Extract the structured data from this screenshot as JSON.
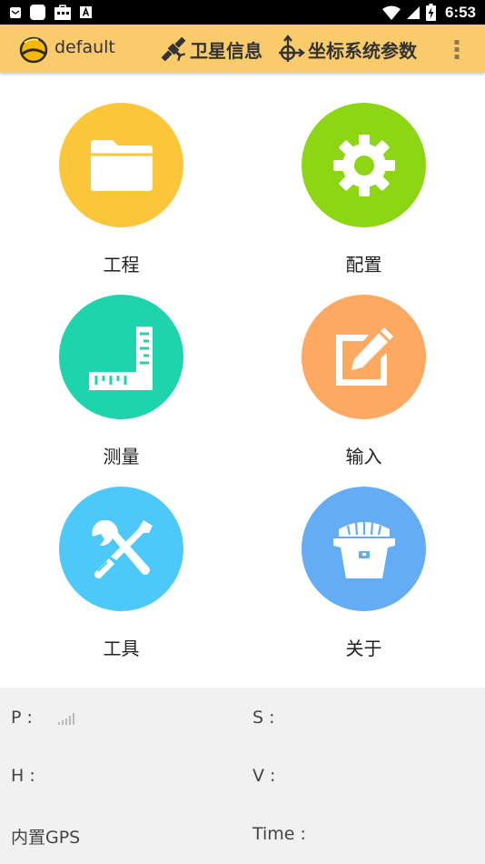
{
  "status_bar": {
    "time": "6:53",
    "icons": [
      "email-icon",
      "app-square-icon",
      "store-icon",
      "font-a-icon",
      "wifi-icon",
      "no-signal-icon",
      "battery-charging-icon"
    ]
  },
  "toolbar": {
    "project_name": "default",
    "satellite_label": "卫星信息",
    "coordinate_label": "坐标系统参数"
  },
  "menu": [
    {
      "label": "工程",
      "color": "#fcc63a",
      "icon": "folder-icon"
    },
    {
      "label": "配置",
      "color": "#8cd614",
      "icon": "gear-icon"
    },
    {
      "label": "测量",
      "color": "#1dd4ac",
      "icon": "ruler-icon"
    },
    {
      "label": "输入",
      "color": "#fea962",
      "icon": "edit-icon"
    },
    {
      "label": "工具",
      "color": "#4cc9f9",
      "icon": "tools-icon"
    },
    {
      "label": "关于",
      "color": "#64adf5",
      "icon": "gnss-receiver-icon"
    }
  ],
  "gps_status": {
    "p_label": "P :",
    "s_label": "S :",
    "h_label": "H :",
    "v_label": "V :",
    "source": "内置GPS",
    "time_label": "Time :"
  },
  "colors": {
    "toolbar": "#f9cb6b",
    "status_background": "#f1f1f1"
  }
}
